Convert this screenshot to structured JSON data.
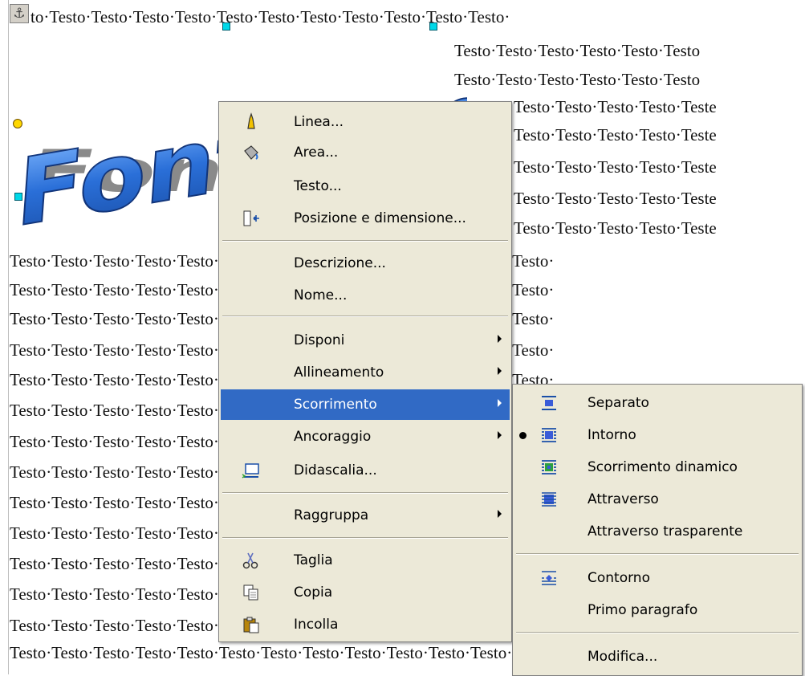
{
  "document": {
    "text_lines": [
      "to·Testo·Testo·Testo·Testo·Testo·Testo·Testo·Testo·Testo·Testo·Testo·",
      "Testo·Testo·Testo·Testo·Testo·Testo",
      "Testo·Testo·Testo·Testo·Testo·Testo",
      "Testo·Testo·Testo·Testo·Teste",
      "Testo·Testo·Testo·Testo·Teste",
      "Testo·Testo·Testo·Testo·Teste",
      "Testo·Testo·Testo·Testo·Teste",
      "Testo·Testo·Testo·Testo·Teste",
      "Testo·Testo·Testo·Testo·Testo·Testo·Testo·Testo·Testo·Testo·Testo·Testo·Testo·",
      "Testo·Testo·Testo·Testo·Testo·Testo·Testo·Testo·Testo·Testo·Testo·Testo·Testo·"
    ],
    "fontwork_text": "Fontwork"
  },
  "context_menu": {
    "items": [
      {
        "label": "Linea...",
        "mnemonic": "L",
        "icon": "pen-icon"
      },
      {
        "label": "Area...",
        "mnemonic": "A",
        "icon": "paint-bucket-icon"
      },
      {
        "label": "Testo...",
        "mnemonic": "T",
        "icon": ""
      },
      {
        "label": "Posizione e dimensione...",
        "mnemonic": "s",
        "icon": "position-size-icon"
      },
      {
        "label": "Descrizione...",
        "mnemonic": "z"
      },
      {
        "label": "Nome...",
        "mnemonic": "N"
      },
      {
        "label": "Disponi",
        "mnemonic": "D",
        "submenu": true
      },
      {
        "label": "Allineamento",
        "mnemonic": "l",
        "submenu": true
      },
      {
        "label": "Scorrimento",
        "mnemonic": "S",
        "submenu": true,
        "active": true
      },
      {
        "label": "Ancoraggio",
        "mnemonic": "A",
        "submenu": true
      },
      {
        "label": "Didascalia...",
        "mnemonic": "c",
        "icon": "caption-icon"
      },
      {
        "label": "Raggruppa",
        "mnemonic": "R",
        "submenu": true
      },
      {
        "label": "Taglia",
        "mnemonic": "g",
        "icon": "scissors-icon"
      },
      {
        "label": "Copia",
        "mnemonic": "C",
        "icon": "copy-icon"
      },
      {
        "label": "Incolla",
        "mnemonic": "I",
        "icon": "paste-icon"
      }
    ]
  },
  "wrap_submenu": {
    "items": [
      {
        "label": "Separato",
        "mnemonic": "S",
        "icon": "wrap-none-icon"
      },
      {
        "label": "Intorno",
        "mnemonic": "I",
        "icon": "wrap-parallel-icon",
        "checked": true
      },
      {
        "label": "Scorrimento dinamico",
        "mnemonic": "d",
        "icon": "wrap-optimal-icon"
      },
      {
        "label": "Attraverso",
        "mnemonic": "A",
        "icon": "wrap-through-icon"
      },
      {
        "label": "Attraverso trasparente",
        "mnemonic": "n"
      },
      {
        "label": "Contorno",
        "mnemonic": "t",
        "icon": "contour-icon"
      },
      {
        "label": "Primo paragrafo",
        "mnemonic": "P"
      },
      {
        "label": "Modifica...",
        "mnemonic": "M"
      }
    ]
  },
  "colors": {
    "menu_bg": "#ece9d8",
    "highlight": "#316ac5",
    "handle": "#00d8e8"
  }
}
